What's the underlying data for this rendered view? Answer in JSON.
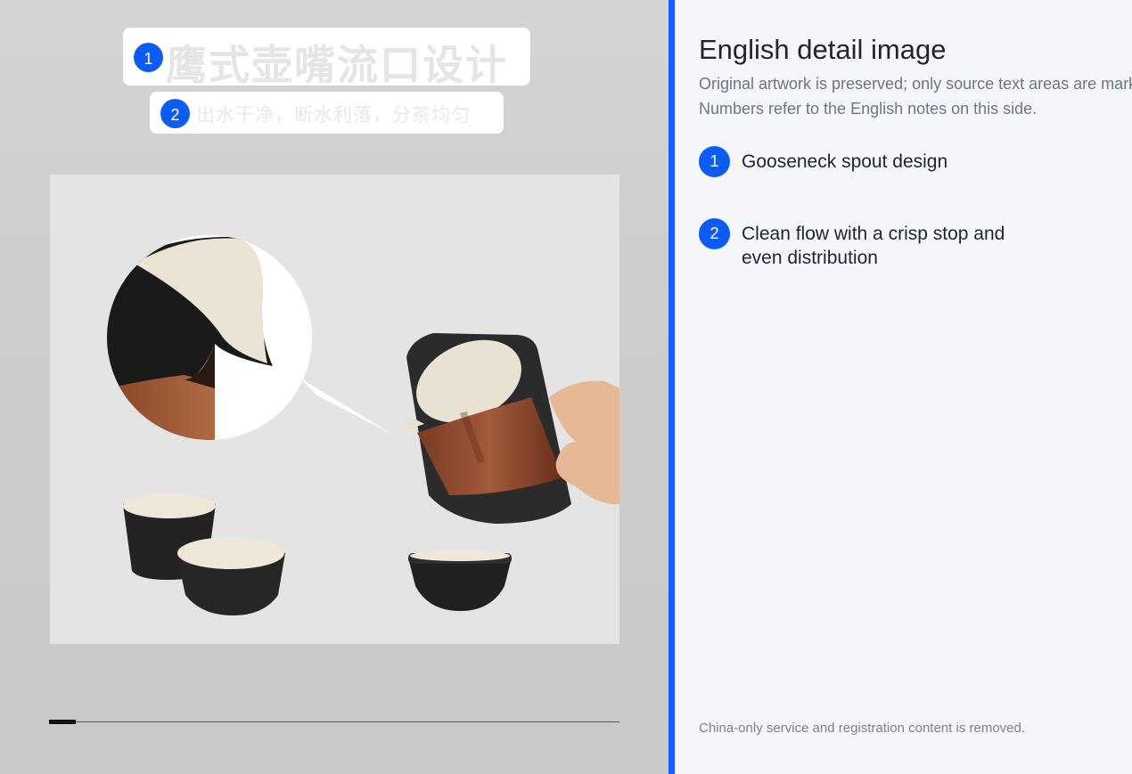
{
  "artwork": {
    "masks": [
      {
        "marker": "1",
        "ghost_text": "鹰式壶嘴流口设计"
      },
      {
        "marker": "2",
        "ghost_text": "出水干净，断水利落，分茶均匀"
      }
    ],
    "progress": {
      "fraction": 0.047
    },
    "colors": {
      "accent": "#1b5cff",
      "marker": "#0c5cf2"
    }
  },
  "notes": {
    "title": "English detail image",
    "subtitle_lines": [
      "Original artwork is preserved; only source text areas are marked.",
      "Numbers refer to the English notes on this side."
    ],
    "items": [
      {
        "number": "1",
        "text": "Gooseneck spout design"
      },
      {
        "number": "2",
        "text": "Clean flow with a crisp stop and even distribution"
      }
    ],
    "footer": "China-only service and registration content is removed."
  }
}
